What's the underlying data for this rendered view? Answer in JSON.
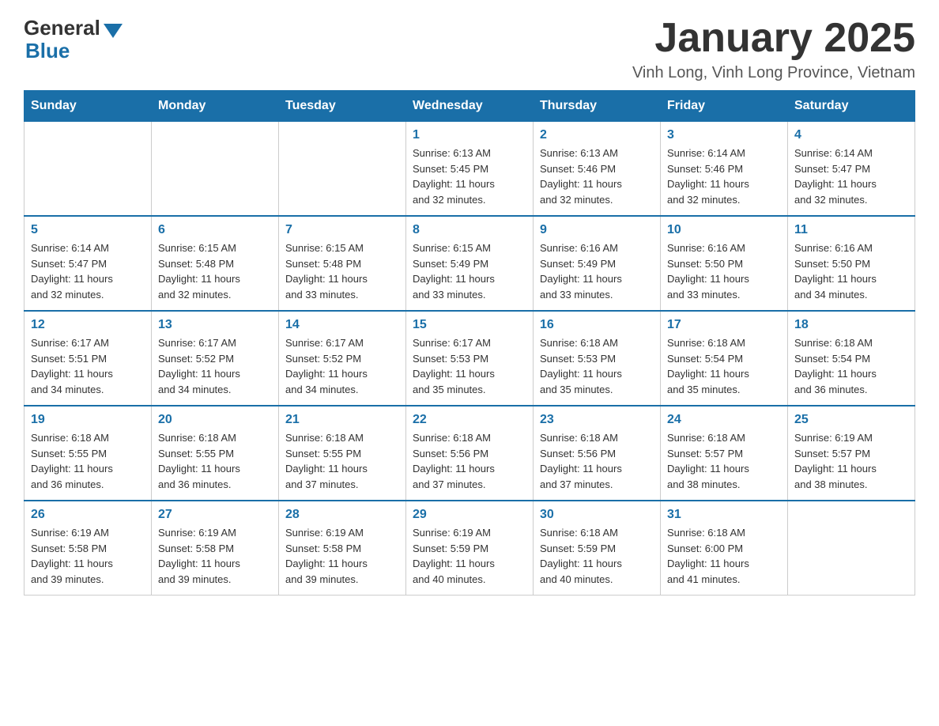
{
  "logo": {
    "general": "General",
    "blue": "Blue"
  },
  "header": {
    "title": "January 2025",
    "location": "Vinh Long, Vinh Long Province, Vietnam"
  },
  "weekdays": [
    "Sunday",
    "Monday",
    "Tuesday",
    "Wednesday",
    "Thursday",
    "Friday",
    "Saturday"
  ],
  "weeks": [
    [
      {
        "day": "",
        "info": ""
      },
      {
        "day": "",
        "info": ""
      },
      {
        "day": "",
        "info": ""
      },
      {
        "day": "1",
        "info": "Sunrise: 6:13 AM\nSunset: 5:45 PM\nDaylight: 11 hours\nand 32 minutes."
      },
      {
        "day": "2",
        "info": "Sunrise: 6:13 AM\nSunset: 5:46 PM\nDaylight: 11 hours\nand 32 minutes."
      },
      {
        "day": "3",
        "info": "Sunrise: 6:14 AM\nSunset: 5:46 PM\nDaylight: 11 hours\nand 32 minutes."
      },
      {
        "day": "4",
        "info": "Sunrise: 6:14 AM\nSunset: 5:47 PM\nDaylight: 11 hours\nand 32 minutes."
      }
    ],
    [
      {
        "day": "5",
        "info": "Sunrise: 6:14 AM\nSunset: 5:47 PM\nDaylight: 11 hours\nand 32 minutes."
      },
      {
        "day": "6",
        "info": "Sunrise: 6:15 AM\nSunset: 5:48 PM\nDaylight: 11 hours\nand 32 minutes."
      },
      {
        "day": "7",
        "info": "Sunrise: 6:15 AM\nSunset: 5:48 PM\nDaylight: 11 hours\nand 33 minutes."
      },
      {
        "day": "8",
        "info": "Sunrise: 6:15 AM\nSunset: 5:49 PM\nDaylight: 11 hours\nand 33 minutes."
      },
      {
        "day": "9",
        "info": "Sunrise: 6:16 AM\nSunset: 5:49 PM\nDaylight: 11 hours\nand 33 minutes."
      },
      {
        "day": "10",
        "info": "Sunrise: 6:16 AM\nSunset: 5:50 PM\nDaylight: 11 hours\nand 33 minutes."
      },
      {
        "day": "11",
        "info": "Sunrise: 6:16 AM\nSunset: 5:50 PM\nDaylight: 11 hours\nand 34 minutes."
      }
    ],
    [
      {
        "day": "12",
        "info": "Sunrise: 6:17 AM\nSunset: 5:51 PM\nDaylight: 11 hours\nand 34 minutes."
      },
      {
        "day": "13",
        "info": "Sunrise: 6:17 AM\nSunset: 5:52 PM\nDaylight: 11 hours\nand 34 minutes."
      },
      {
        "day": "14",
        "info": "Sunrise: 6:17 AM\nSunset: 5:52 PM\nDaylight: 11 hours\nand 34 minutes."
      },
      {
        "day": "15",
        "info": "Sunrise: 6:17 AM\nSunset: 5:53 PM\nDaylight: 11 hours\nand 35 minutes."
      },
      {
        "day": "16",
        "info": "Sunrise: 6:18 AM\nSunset: 5:53 PM\nDaylight: 11 hours\nand 35 minutes."
      },
      {
        "day": "17",
        "info": "Sunrise: 6:18 AM\nSunset: 5:54 PM\nDaylight: 11 hours\nand 35 minutes."
      },
      {
        "day": "18",
        "info": "Sunrise: 6:18 AM\nSunset: 5:54 PM\nDaylight: 11 hours\nand 36 minutes."
      }
    ],
    [
      {
        "day": "19",
        "info": "Sunrise: 6:18 AM\nSunset: 5:55 PM\nDaylight: 11 hours\nand 36 minutes."
      },
      {
        "day": "20",
        "info": "Sunrise: 6:18 AM\nSunset: 5:55 PM\nDaylight: 11 hours\nand 36 minutes."
      },
      {
        "day": "21",
        "info": "Sunrise: 6:18 AM\nSunset: 5:55 PM\nDaylight: 11 hours\nand 37 minutes."
      },
      {
        "day": "22",
        "info": "Sunrise: 6:18 AM\nSunset: 5:56 PM\nDaylight: 11 hours\nand 37 minutes."
      },
      {
        "day": "23",
        "info": "Sunrise: 6:18 AM\nSunset: 5:56 PM\nDaylight: 11 hours\nand 37 minutes."
      },
      {
        "day": "24",
        "info": "Sunrise: 6:18 AM\nSunset: 5:57 PM\nDaylight: 11 hours\nand 38 minutes."
      },
      {
        "day": "25",
        "info": "Sunrise: 6:19 AM\nSunset: 5:57 PM\nDaylight: 11 hours\nand 38 minutes."
      }
    ],
    [
      {
        "day": "26",
        "info": "Sunrise: 6:19 AM\nSunset: 5:58 PM\nDaylight: 11 hours\nand 39 minutes."
      },
      {
        "day": "27",
        "info": "Sunrise: 6:19 AM\nSunset: 5:58 PM\nDaylight: 11 hours\nand 39 minutes."
      },
      {
        "day": "28",
        "info": "Sunrise: 6:19 AM\nSunset: 5:58 PM\nDaylight: 11 hours\nand 39 minutes."
      },
      {
        "day": "29",
        "info": "Sunrise: 6:19 AM\nSunset: 5:59 PM\nDaylight: 11 hours\nand 40 minutes."
      },
      {
        "day": "30",
        "info": "Sunrise: 6:18 AM\nSunset: 5:59 PM\nDaylight: 11 hours\nand 40 minutes."
      },
      {
        "day": "31",
        "info": "Sunrise: 6:18 AM\nSunset: 6:00 PM\nDaylight: 11 hours\nand 41 minutes."
      },
      {
        "day": "",
        "info": ""
      }
    ]
  ]
}
